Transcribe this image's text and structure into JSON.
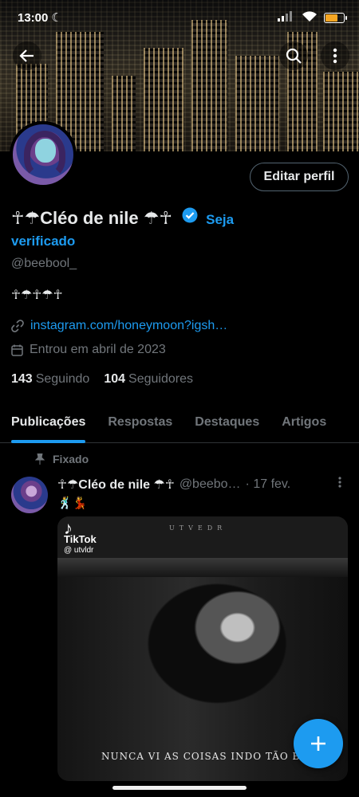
{
  "status_bar": {
    "time": "13:00"
  },
  "profile": {
    "name": "☥☂Cléo de nile ☂☥",
    "verify_prompt_1": "Seja",
    "verify_prompt_2": "verificado",
    "handle": "@beebool_",
    "bio": "☥☂☥☂☥",
    "link": "instagram.com/honeymoon?igsh…",
    "joined": "Entrou em abril de 2023",
    "following_count": "143",
    "following_label": "Seguindo",
    "followers_count": "104",
    "followers_label": "Seguidores",
    "edit_label": "Editar perfil"
  },
  "tabs": [
    {
      "label": "Publicações",
      "active": true
    },
    {
      "label": "Respostas"
    },
    {
      "label": "Destaques"
    },
    {
      "label": "Artigos"
    }
  ],
  "pinned_post": {
    "pinned_label": "Fixado",
    "author_name": "☥☂Cléo de nile ☂☥",
    "author_handle": "@beebo…",
    "date": "· 17 fev.",
    "emoji": "🕺💃",
    "media": {
      "tiktok_brand": "TikTok",
      "tiktok_user": "@ utvldr",
      "watermark": "UTVEDR",
      "caption": "NUNCA VI AS COISAS INDO TÃO BE"
    }
  },
  "colors": {
    "accent": "#1d9bf0",
    "background": "#000000",
    "muted": "#71767b",
    "text": "#e7e9ea"
  }
}
